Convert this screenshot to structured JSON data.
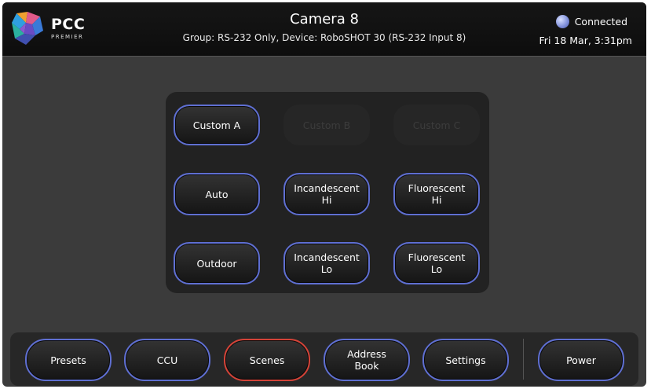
{
  "header": {
    "logo": {
      "brand": "PCC",
      "sub": "PREMIER"
    },
    "title": "Camera 8",
    "subtitle": "Group: RS-232 Only,  Device: RoboSHOT 30 (RS-232 Input 8)",
    "status": {
      "label": "Connected",
      "icon": "connection-status-icon"
    },
    "datetime": "Fri 18 Mar, 3:31pm"
  },
  "scenes": {
    "custom_a": "Custom A",
    "custom_b": "Custom B",
    "custom_c": "Custom C",
    "auto": "Auto",
    "incandescent_hi": "Incandescent\nHi",
    "fluorescent_hi": "Fluorescent\nHi",
    "outdoor": "Outdoor",
    "incandescent_lo": "Incandescent\nLo",
    "fluorescent_lo": "Fluorescent\nLo"
  },
  "nav": {
    "presets": "Presets",
    "ccu": "CCU",
    "scenes": "Scenes",
    "address_book": "Address\nBook",
    "settings": "Settings",
    "power": "Power"
  },
  "colors": {
    "button_border": "#5f6fd2",
    "active_border": "#d44338",
    "background": "#3b3b3b"
  }
}
